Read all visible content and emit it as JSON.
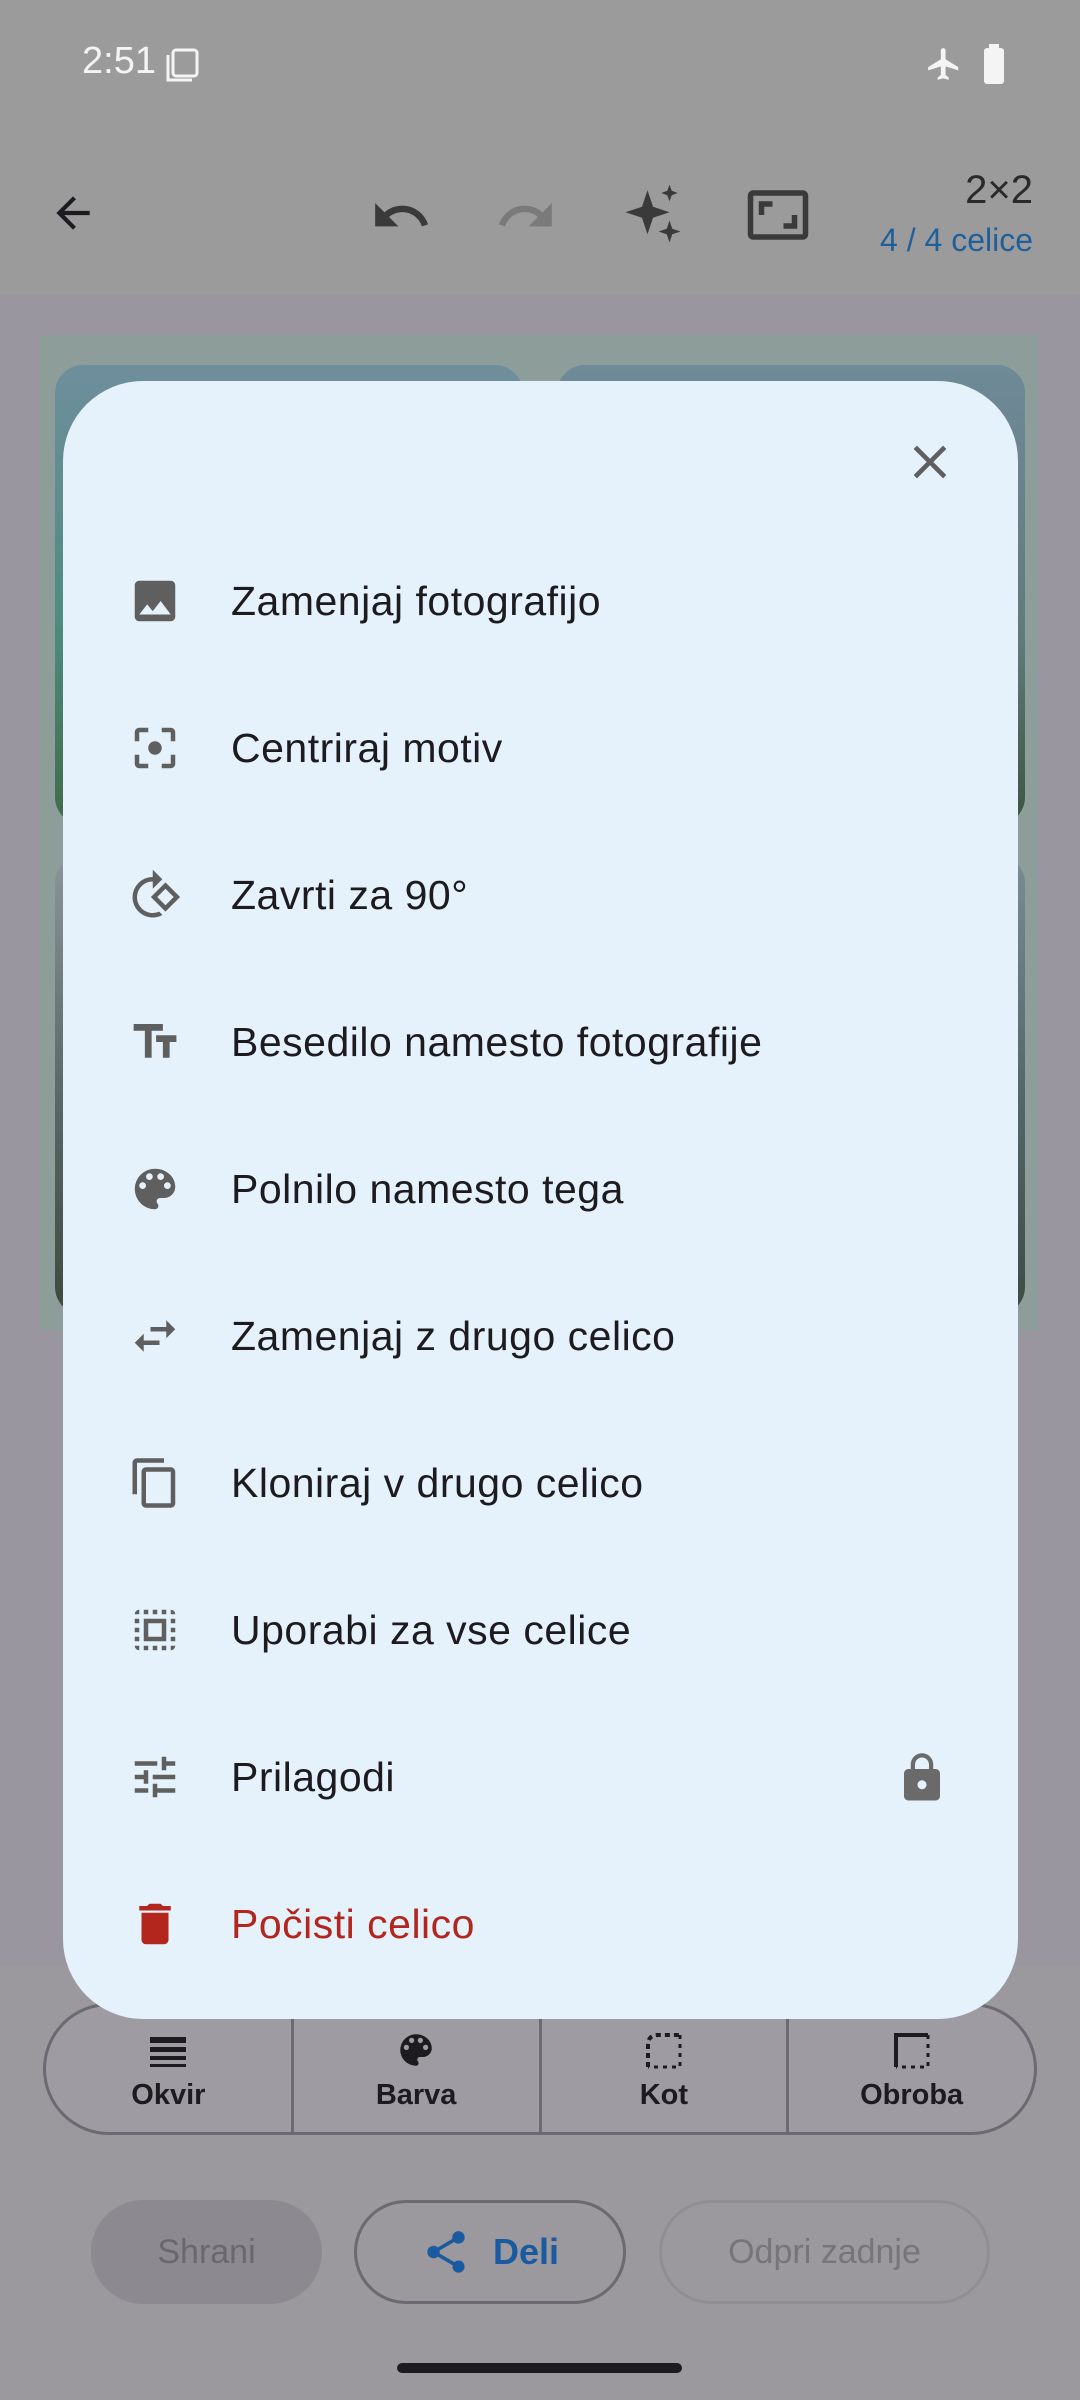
{
  "status_bar": {
    "time": "2:51"
  },
  "toolbar": {
    "grid_size": "2×2",
    "cell_count": "4 / 4 celice"
  },
  "dialog": {
    "menu": [
      {
        "label": "Zamenjaj fotografijo",
        "icon": "image-icon"
      },
      {
        "label": "Centriraj motiv",
        "icon": "center-focus-icon"
      },
      {
        "label": "Zavrti za 90°",
        "icon": "rotate-icon"
      },
      {
        "label": "Besedilo namesto fotografije",
        "icon": "text-fields-icon"
      },
      {
        "label": "Polnilo namesto tega",
        "icon": "palette-icon"
      },
      {
        "label": "Zamenjaj z drugo celico",
        "icon": "swap-icon"
      },
      {
        "label": "Kloniraj v drugo celico",
        "icon": "copy-icon"
      },
      {
        "label": "Uporabi za vse celice",
        "icon": "select-all-icon"
      },
      {
        "label": "Prilagodi",
        "icon": "tune-icon",
        "locked": true
      },
      {
        "label": "Počisti celico",
        "icon": "delete-icon",
        "danger": true
      }
    ],
    "danger_color": "#b3261e"
  },
  "tabs": [
    {
      "label": "Okvir",
      "icon": "frame-lines-icon"
    },
    {
      "label": "Barva",
      "icon": "palette-icon"
    },
    {
      "label": "Kot",
      "icon": "corner-icon"
    },
    {
      "label": "Obroba",
      "icon": "border-icon"
    }
  ],
  "actions": {
    "save": "Shrani",
    "share": "Deli",
    "open_last": "Odpri zadnje"
  },
  "colors": {
    "dialog_bg": "#e5f2fc",
    "accent": "#1a5aa0",
    "scrim": "#9b999d"
  }
}
